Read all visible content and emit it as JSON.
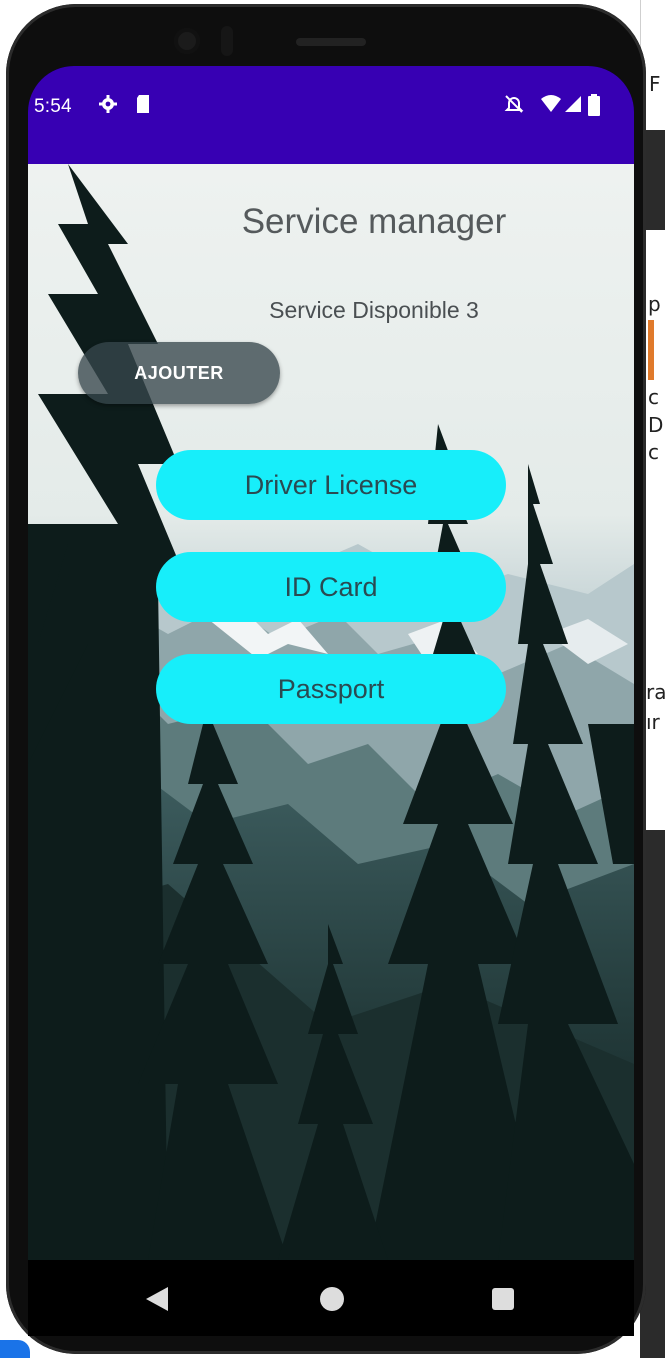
{
  "status_bar": {
    "time": "5:54",
    "left_icons": [
      "gear-icon",
      "sd-card-icon"
    ],
    "right_icons": [
      "mute-icon",
      "wifi-icon",
      "signal-icon",
      "battery-icon"
    ],
    "color": "#3700b3"
  },
  "app": {
    "title": "Service manager",
    "available_label": "Service Disponible 3",
    "add_button": "AJOUTER",
    "services": [
      {
        "label": "Driver License"
      },
      {
        "label": "ID Card"
      },
      {
        "label": "Passport"
      }
    ],
    "service_button_color": "#17eefa"
  },
  "nav_bar": {
    "icons": [
      "back-icon",
      "home-icon",
      "recents-icon"
    ]
  },
  "ide_fragments": [
    "F",
    "p",
    "c",
    "D",
    "c",
    "ra",
    "ır"
  ]
}
